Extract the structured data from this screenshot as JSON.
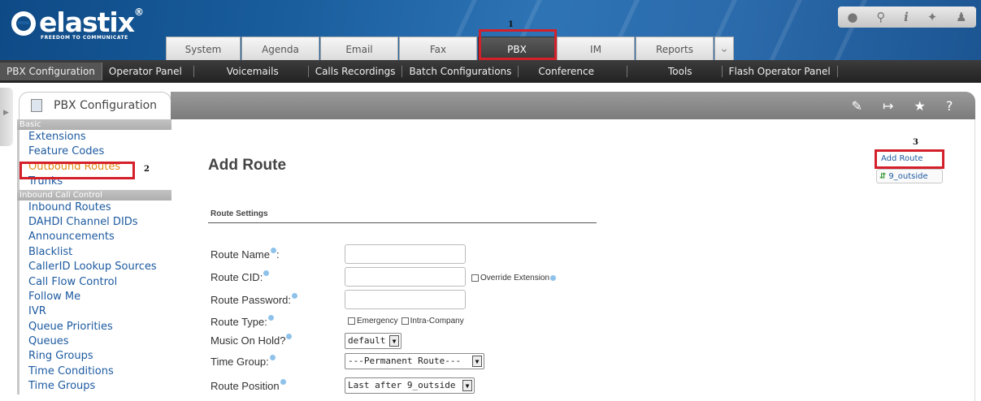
{
  "brand": {
    "name": "elastix",
    "registered": "®",
    "tagline": "FREEDOM TO COMMUNICATE"
  },
  "main_tabs": [
    {
      "label": "System"
    },
    {
      "label": "Agenda"
    },
    {
      "label": "Email"
    },
    {
      "label": "Fax"
    },
    {
      "label": "PBX",
      "active": true
    },
    {
      "label": "IM"
    },
    {
      "label": "Reports"
    }
  ],
  "more_tabs_icon": "chevron-down-icon",
  "top_icons": [
    "water-drop-icon",
    "search-icon",
    "info-icon",
    "puzzle-icon",
    "user-icon"
  ],
  "subnav": [
    {
      "label": "PBX Configuration",
      "active": true
    },
    {
      "label": "Operator Panel"
    },
    {
      "label": "Voicemails"
    },
    {
      "label": "Calls Recordings"
    },
    {
      "label": "Batch Configurations"
    },
    {
      "label": "Conference"
    },
    {
      "label": "Tools"
    },
    {
      "label": "Flash Operator Panel"
    }
  ],
  "module": {
    "title": "PBX Configuration",
    "tool_icons": [
      "edit-icon",
      "next-icon",
      "star-icon",
      "help-icon"
    ]
  },
  "annotations": {
    "n1": "1",
    "n2": "2",
    "n3": "3",
    "accent": "#d4202a"
  },
  "left_menu": {
    "basic_header": "Basic",
    "basic_items": [
      "Extensions",
      "Feature Codes",
      "Outbound Routes",
      "Trunks"
    ],
    "inbound_header": "Inbound Call Control",
    "inbound_items": [
      "Inbound Routes",
      "DAHDI Channel DIDs",
      "Announcements",
      "Blacklist",
      "CallerID Lookup Sources",
      "Call Flow Control",
      "Follow Me",
      "IVR",
      "Queue Priorities",
      "Queues",
      "Ring Groups",
      "Time Conditions",
      "Time Groups"
    ],
    "active_item": "Outbound Routes"
  },
  "content": {
    "page_title": "Add Route",
    "section_title": "Route Settings",
    "labels": {
      "route_name": "Route Name",
      "route_name_suffix": ":",
      "route_cid": "Route CID:",
      "route_password": "Route Password:",
      "route_type": "Route Type:",
      "music_on_hold": "Music On Hold?",
      "time_group": "Time Group:",
      "route_position": "Route Position"
    },
    "checkboxes": {
      "override_extension": "Override Extension",
      "emergency": "Emergency",
      "intra_company": "Intra-Company"
    },
    "selects": {
      "music_on_hold": "default",
      "time_group": "---Permanent Route---",
      "route_position": "Last after 9_outside"
    }
  },
  "route_list": {
    "add_route": "Add Route",
    "routes": [
      "9_outside"
    ]
  }
}
